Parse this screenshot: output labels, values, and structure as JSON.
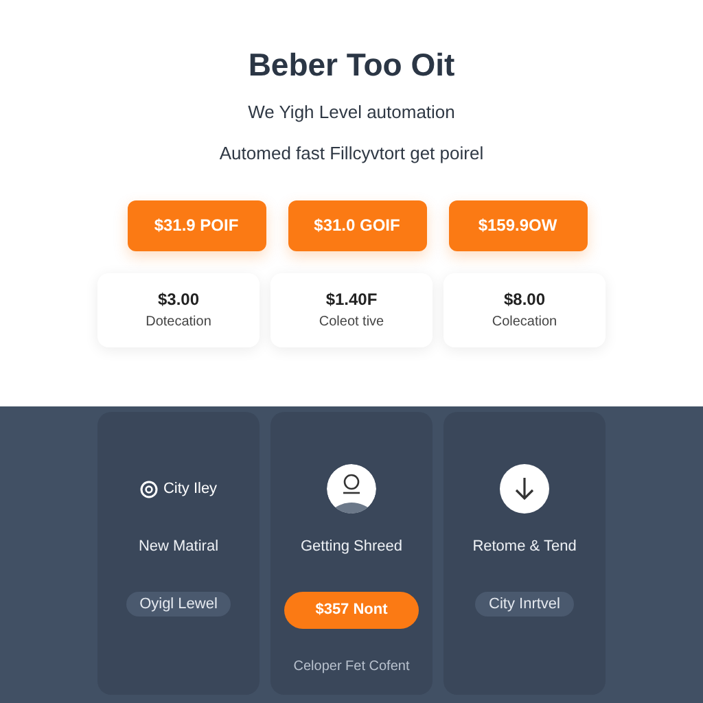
{
  "header": {
    "title": "Beber Too Oit",
    "subtitle": "We Yigh Level automation",
    "tagline": "Automed fast Fillcyvtort get poirel"
  },
  "price_buttons": [
    "$31.9 POIF",
    "$31.0 GOIF",
    "$159.9OW"
  ],
  "price_cards": [
    {
      "amount": "$3.00",
      "label": "Dotecation"
    },
    {
      "amount": "$1.40F",
      "label": "Coleot tive"
    },
    {
      "amount": "$8.00",
      "label": "Colecation"
    }
  ],
  "features": [
    {
      "kind": "brand",
      "brand_label": "City Iley",
      "title": "New Matiral",
      "tag": "Oyigl Lewel"
    },
    {
      "kind": "avatar",
      "title": "Getting Shreed",
      "button": "$357 Nont",
      "caption": "Celoper Fet Cofent"
    },
    {
      "kind": "download",
      "title": "Retome & Tend",
      "tag": "City Inrtvel"
    }
  ]
}
